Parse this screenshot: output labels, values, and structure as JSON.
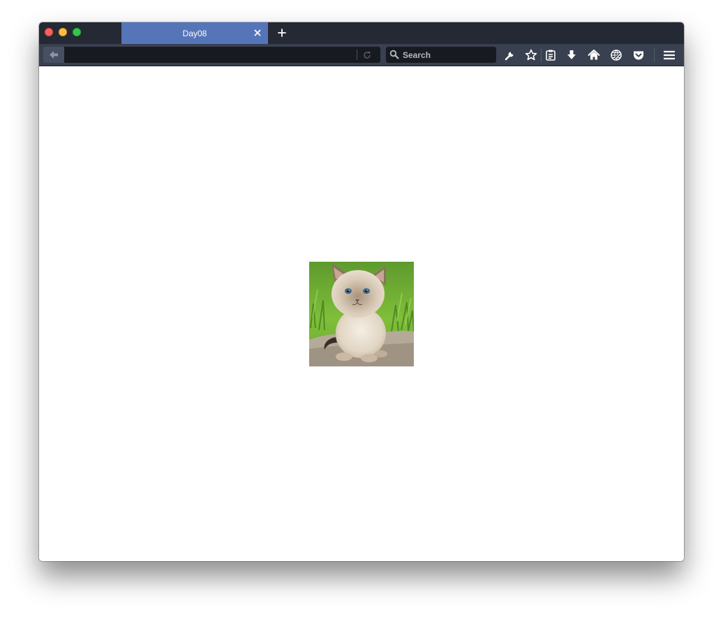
{
  "tabs": [
    {
      "title": "Day08",
      "active": true
    }
  ],
  "urlbar": {
    "value": ""
  },
  "search": {
    "placeholder": "Search"
  },
  "toolbar": {
    "icons": [
      "wrench-icon",
      "star-icon",
      "reading-list-icon",
      "download-icon",
      "home-icon",
      "synced-tabs-icon",
      "pocket-icon",
      "hamburger-menu-icon"
    ]
  },
  "content": {
    "image": {
      "subject": "kitten"
    }
  },
  "colors": {
    "tab_active": "#5675b9",
    "tabstrip": "#252934",
    "toolbar": "#39404f",
    "field": "#171a20"
  }
}
